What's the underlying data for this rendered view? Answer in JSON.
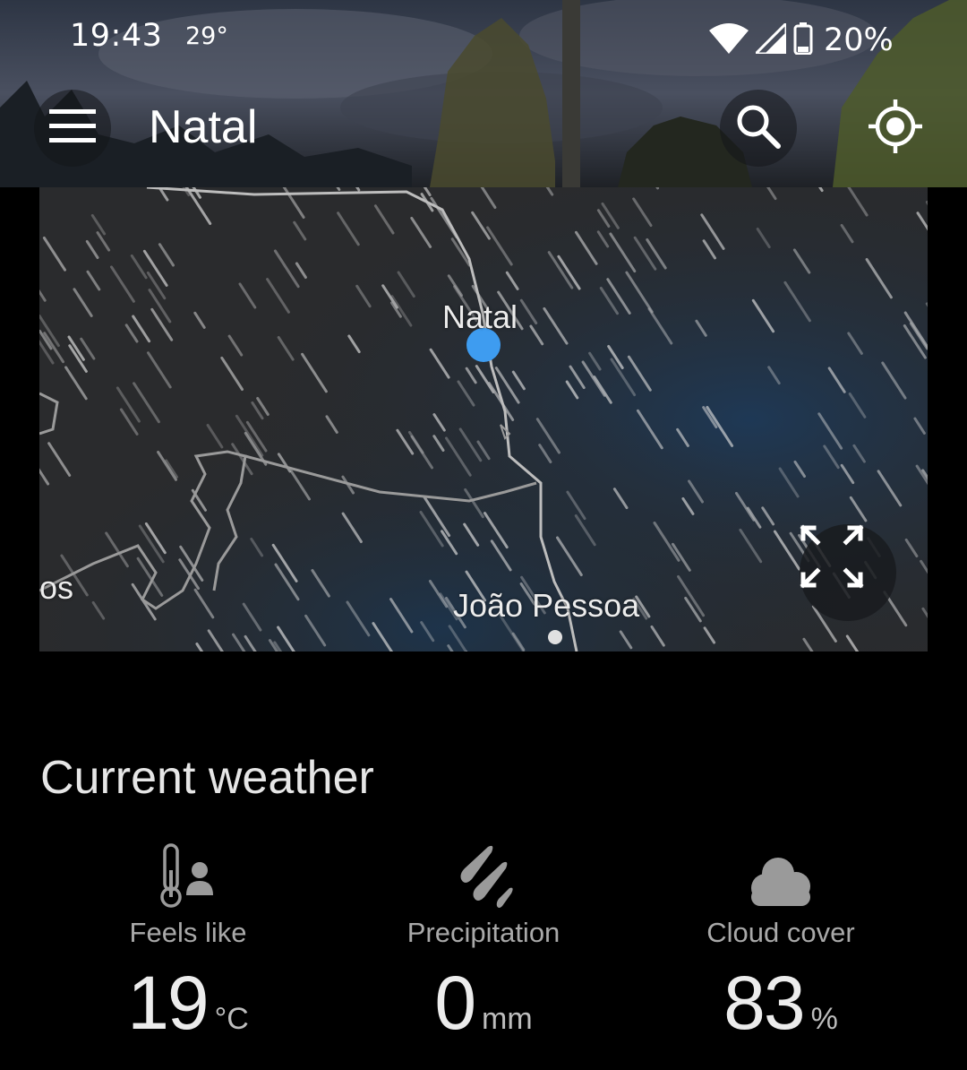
{
  "status_bar": {
    "time": "19:43",
    "temperature": "29°",
    "battery": "20%"
  },
  "app_bar": {
    "title": "Natal",
    "icons": [
      "menu-icon",
      "search-icon",
      "my-location-icon"
    ]
  },
  "map": {
    "labels": {
      "city": "Natal",
      "nearby_city": "João Pessoa",
      "edge_left": "os"
    },
    "icons": [
      "location-dot-icon",
      "fullscreen-icon"
    ],
    "accent_color": "#3e9cf0"
  },
  "current_weather": {
    "title": "Current weather",
    "metrics": [
      {
        "label": "Feels like",
        "value": "19",
        "unit": "°C",
        "icon": "thermometer-person-icon"
      },
      {
        "label": "Precipitation",
        "value": "0",
        "unit": "mm",
        "icon": "rain-drops-icon"
      },
      {
        "label": "Cloud cover",
        "value": "83",
        "unit": "%",
        "icon": "cloud-icon"
      }
    ]
  }
}
